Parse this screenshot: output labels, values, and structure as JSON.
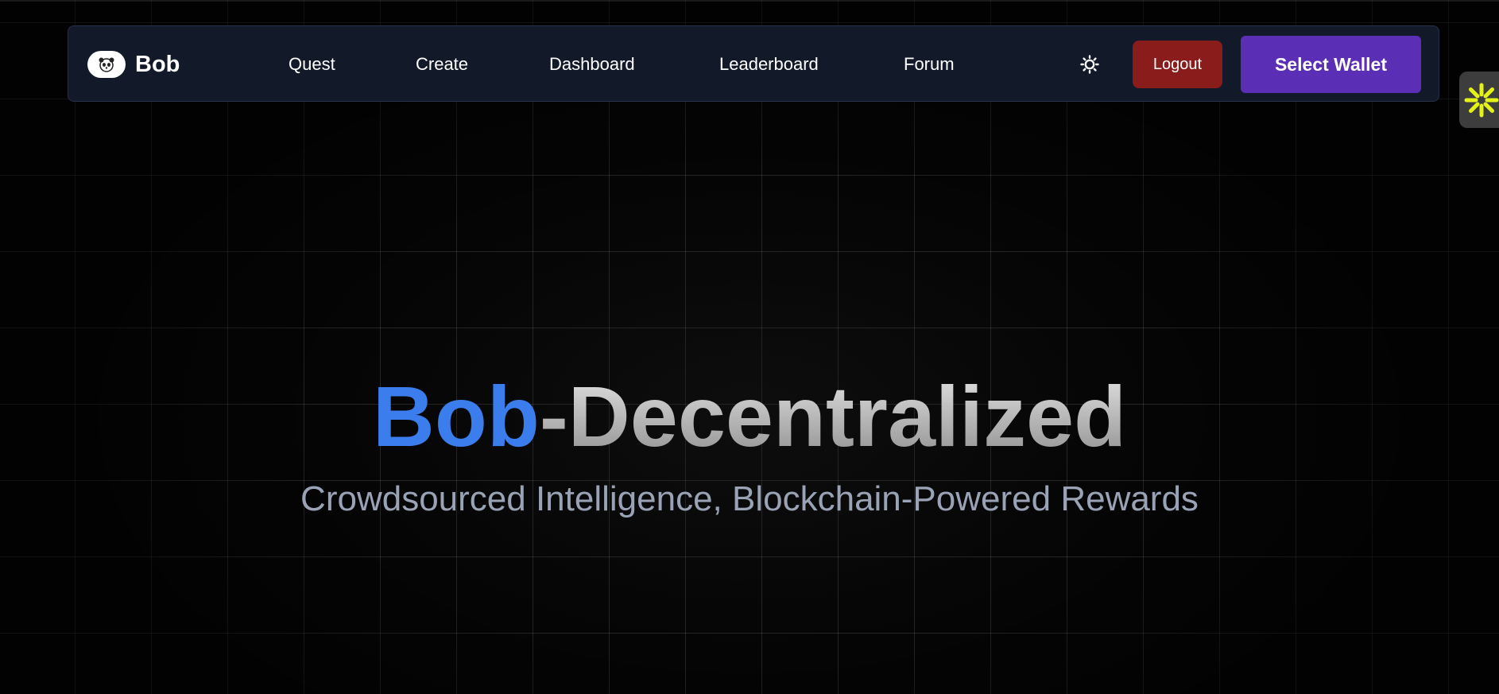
{
  "navbar": {
    "brand": {
      "logo_icon": "panda-icon",
      "name": "Bob"
    },
    "links": [
      {
        "label": "Quest"
      },
      {
        "label": "Create"
      },
      {
        "label": "Dashboard"
      },
      {
        "label": "Leaderboard"
      },
      {
        "label": "Forum"
      }
    ],
    "theme_toggle_icon": "sun-icon",
    "logout_label": "Logout",
    "wallet_label": "Select Wallet"
  },
  "side_widget": {
    "icon": "asterisk-burst-icon",
    "icon_color": "#e4f218"
  },
  "hero": {
    "title_accent": "Bob",
    "title_rest": "-Decentralized",
    "subtitle": "Crowdsourced Intelligence, Blockchain-Powered Rewards"
  },
  "colors": {
    "background": "#050505",
    "navbar_bg": "#121a2a",
    "logout_bg": "#8a1c1c",
    "wallet_bg": "#5b2fb5",
    "accent_blue": "#3b7ded",
    "subtitle": "#9aa3b5"
  }
}
